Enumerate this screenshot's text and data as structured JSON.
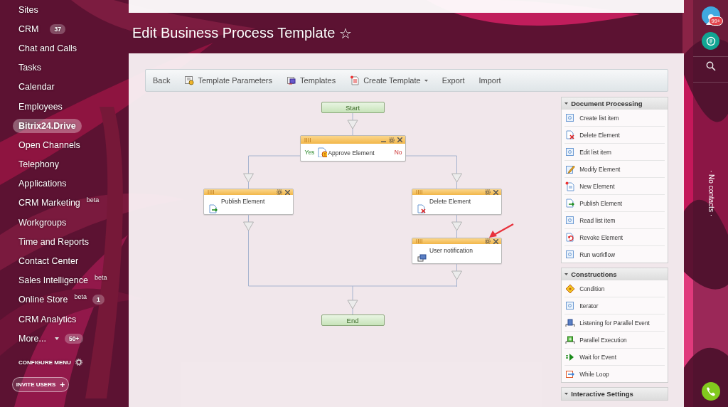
{
  "sidebar": {
    "items": [
      {
        "label": "Sites",
        "selected": false,
        "dropdown": false
      },
      {
        "label": "CRM",
        "badge": "37",
        "selected": false,
        "dropdown": false
      },
      {
        "label": "Chat and Calls",
        "selected": false,
        "dropdown": false
      },
      {
        "label": "Tasks",
        "selected": false,
        "dropdown": false
      },
      {
        "label": "Calendar",
        "selected": false,
        "dropdown": false
      },
      {
        "label": "Employees",
        "selected": false,
        "dropdown": false
      },
      {
        "label": "Bitrix24.Drive",
        "selected": true,
        "dropdown": false
      },
      {
        "label": "Open Channels",
        "selected": false,
        "dropdown": false
      },
      {
        "label": "Telephony",
        "selected": false,
        "dropdown": false
      },
      {
        "label": "Applications",
        "selected": false,
        "dropdown": false
      },
      {
        "label": "CRM Marketing",
        "sup": "beta",
        "selected": false,
        "dropdown": false
      },
      {
        "label": "Workgroups",
        "selected": false,
        "dropdown": false
      },
      {
        "label": "Time and Reports",
        "selected": false,
        "dropdown": false
      },
      {
        "label": "Contact Center",
        "selected": false,
        "dropdown": false
      },
      {
        "label": "Sales Intelligence",
        "sup": "beta",
        "selected": false,
        "dropdown": false
      },
      {
        "label": "Online Store",
        "sup": "beta",
        "badge": "1",
        "selected": false,
        "dropdown": false
      },
      {
        "label": "CRM Analytics",
        "selected": false,
        "dropdown": false
      },
      {
        "label": "More...",
        "badge": "50+",
        "selected": false,
        "dropdown": true
      }
    ],
    "configure_menu": "CONFIGURE MENU",
    "invite_button": "INVITE USERS",
    "invite_icon": "+"
  },
  "header": {
    "title": "Edit Business Process Template",
    "star": "☆"
  },
  "toolbar": {
    "items": [
      {
        "label": "Back",
        "dropdown": false
      },
      {
        "label": "Template Parameters",
        "dropdown": false
      },
      {
        "label": "Templates",
        "dropdown": false
      },
      {
        "label": "Create Template",
        "dropdown": true
      },
      {
        "label": "Export",
        "dropdown": false
      },
      {
        "label": "Import",
        "dropdown": false
      }
    ]
  },
  "diagram": {
    "start": "Start",
    "end": "End",
    "condition": {
      "label": "Approve Element",
      "minimizable": true,
      "branches": [
        {
          "label": "Yes",
          "steps": [
            {
              "label": "Publish Element",
              "pointed": false
            }
          ]
        },
        {
          "label": "No",
          "steps": [
            {
              "label": "Delete Element",
              "pointed": false
            },
            {
              "label": "User notification",
              "pointed": true
            }
          ]
        }
      ]
    }
  },
  "palette": {
    "groups": [
      {
        "title": "Document Processing",
        "expanded": true,
        "items": [
          {
            "label": "Create list item"
          },
          {
            "label": "Delete Element"
          },
          {
            "label": "Edit list item"
          },
          {
            "label": "Modify Element"
          },
          {
            "label": "New Element"
          },
          {
            "label": "Publish Element"
          },
          {
            "label": "Read list item"
          },
          {
            "label": "Revoke Element"
          },
          {
            "label": "Run workflow"
          }
        ]
      },
      {
        "title": "Constructions",
        "expanded": true,
        "items": [
          {
            "label": "Condition"
          },
          {
            "label": "Iterator"
          },
          {
            "label": "Listening for Parallel Event"
          },
          {
            "label": "Parallel Execution"
          },
          {
            "label": "Wait for Event"
          },
          {
            "label": "While Loop"
          }
        ]
      },
      {
        "title": "Interactive Settings",
        "expanded": true
      }
    ]
  },
  "right_bar": {
    "notifications_badge": "99+",
    "contacts_note": "· No contacts ·"
  }
}
